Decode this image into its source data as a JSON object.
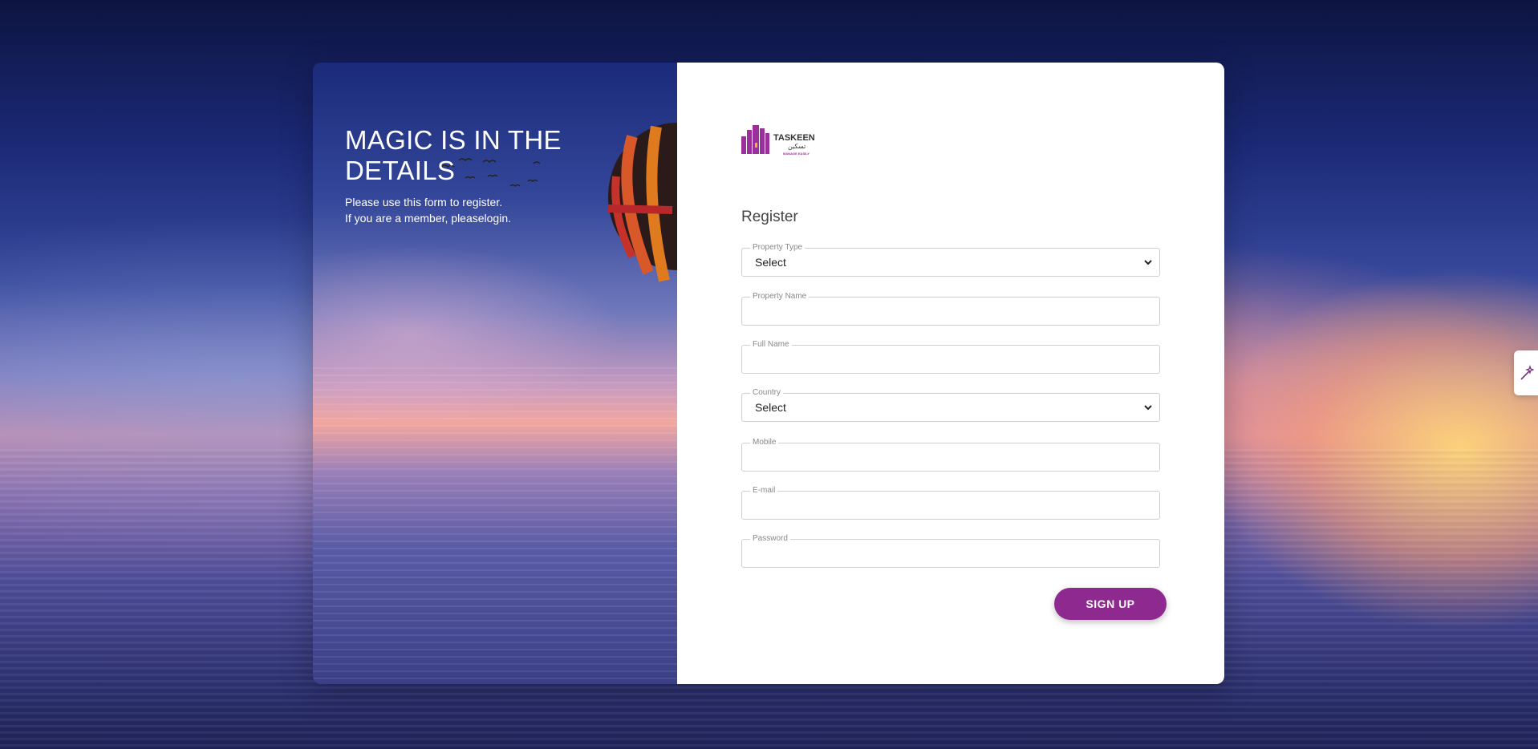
{
  "left": {
    "title": "MAGIC IS IN THE DETAILS",
    "line1": "Please use this form to register.",
    "line2": "If you are a member, pleaselogin."
  },
  "logo": {
    "brand": "TASKEEN",
    "arabic": "تسكين",
    "tagline": "MANAGE EASILY",
    "color": "#9b2f9c"
  },
  "form": {
    "title": "Register",
    "fields": [
      {
        "label": "Property Type",
        "value": "Select",
        "type": "select"
      },
      {
        "label": "Property Name",
        "value": "",
        "type": "text"
      },
      {
        "label": "Full Name",
        "value": "",
        "type": "text"
      },
      {
        "label": "Country",
        "value": "Select",
        "type": "select"
      },
      {
        "label": "Mobile",
        "value": "",
        "type": "text"
      },
      {
        "label": "E-mail",
        "value": "",
        "type": "text"
      },
      {
        "label": "Password",
        "value": "",
        "type": "password"
      }
    ],
    "submit_label": "SIGN UP"
  },
  "colors": {
    "accent": "#8e2a8f",
    "panel_bg": "#ffffff"
  },
  "side_widget": {
    "icon": "magic-wand-icon"
  }
}
